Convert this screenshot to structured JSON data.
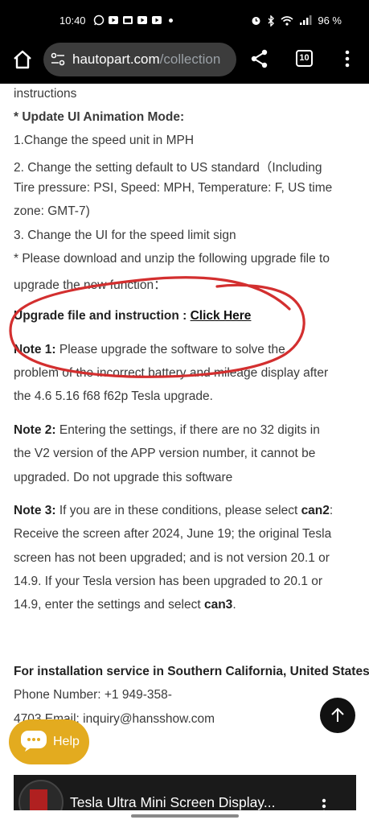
{
  "status_bar": {
    "time": "10:40",
    "notifications": [
      "whatsapp-icon",
      "youtube-icon",
      "calendar-icon",
      "youtube-icon",
      "youtube-icon"
    ],
    "battery": "96 %"
  },
  "browser": {
    "url_domain": "hautopart.com",
    "url_path": "/collection",
    "tab_count": "10"
  },
  "article": {
    "line_instructions": "instructions",
    "update_heading": "* Update UI Animation Mode:",
    "item1": "1.Change the speed unit in MPH",
    "item2_line1": "2. Change the setting default to US standard（Including",
    "item2_line2": "Tire pressure: PSI, Speed: MPH, Temperature: F, US time",
    "item2_line3": "zone: GMT-7)",
    "item3": "3. Change the UI for the speed limit sign",
    "download_line1": "* Please download and unzip the following upgrade file to",
    "download_line2": "upgrade the new function：",
    "upgrade_label": "Upgrade file and instruction :",
    "upgrade_link": "Click Here",
    "note1_label": "Note 1:",
    "note1_line1": " Please upgrade the software to solve the",
    "note1_line2": "problem of the incorrect battery and mileage display after",
    "note1_line3": "the 4.6 5.16 f68 f62p Tesla upgrade.",
    "note2_label": "Note 2:",
    "note2_line1": " Entering the settings, if there are no 32 digits in",
    "note2_line2": "the V2 version of the APP version number, it cannot be",
    "note2_line3": "upgraded. Do not upgrade this software",
    "note3_label": "Note 3:",
    "note3_line1a": " If you are in these conditions, please select ",
    "note3_can2": "can2",
    "note3_line1b": ":",
    "note3_line2": "Receive the screen after 2024, June 19; the original Tesla",
    "note3_line3": "screen has not been upgraded; and is not version 20.1 or",
    "note3_line4": "14.9.  If your Tesla version has been upgraded to 20.1 or",
    "note3_line5a": "14.9, enter the settings and select ",
    "note3_can3": "can3",
    "note3_line5b": ".",
    "install_heading": "For installation service in Southern California, United States",
    "phone_line": "Phone Number: +1 949-358-",
    "email_line": "4703 Email: inquiry@hansshow.com"
  },
  "help_button": {
    "label": "Help"
  },
  "video": {
    "title": "Tesla Ultra Mini Screen Display..."
  },
  "colors": {
    "annotation_red": "#d32f2f",
    "help_bg": "#e3ab1f"
  }
}
